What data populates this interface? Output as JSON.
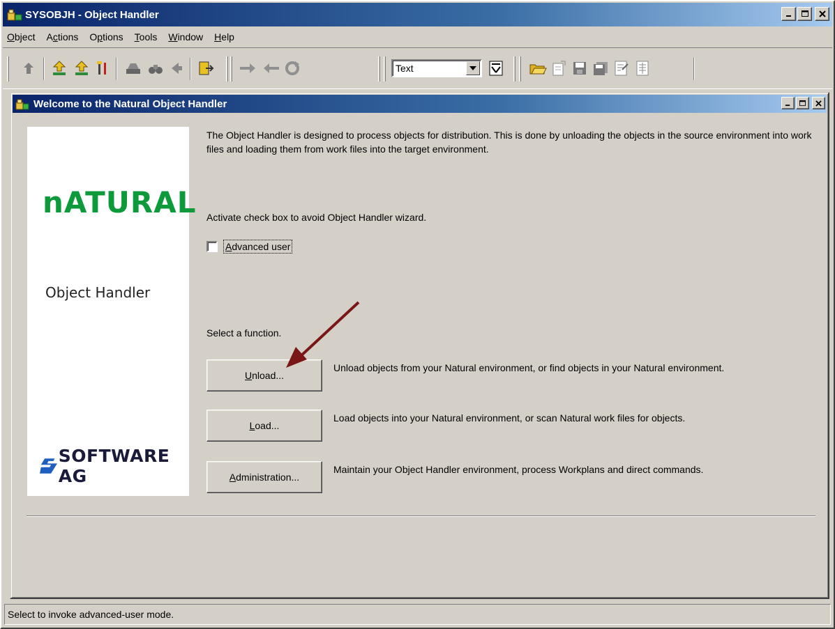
{
  "window": {
    "title": "SYSOBJH - Object Handler",
    "minimize": "_",
    "maximize": "□",
    "close": "×"
  },
  "menu": {
    "items": [
      {
        "label": "Object"
      },
      {
        "label": "Actions"
      },
      {
        "label": "Options"
      },
      {
        "label": "Tools"
      },
      {
        "label": "Window"
      },
      {
        "label": "Help"
      }
    ]
  },
  "toolbar": {
    "view_select_value": "Text",
    "icons": [
      "up-arrow-icon",
      "upload-icon",
      "upload-alt-icon",
      "tools-icon",
      "print-icon",
      "binoculars-icon",
      "back-icon",
      "exit-icon",
      "forward-arrow-icon",
      "back-arrow-icon",
      "refresh-icon",
      "view-icon",
      "open-folder-icon",
      "new-document-icon",
      "save-icon",
      "save-all-icon",
      "properties-icon",
      "list-icon"
    ]
  },
  "child_window": {
    "title": "Welcome to the Natural Object Handler"
  },
  "logo_panel": {
    "natural_logo": "nATURAL",
    "product_name": "Object Handler",
    "company_logo": "SOFTWARE AG"
  },
  "content": {
    "intro": "The Object Handler is designed to process objects for distribution. This is done by unloading the objects in the source environment into work files and loading them from work files into the target environment.",
    "checkbox_hint": "Activate check box to avoid Object Handler wizard.",
    "checkbox_label": "Advanced user",
    "checkbox_checked": false,
    "select_function": "Select a function.",
    "functions": [
      {
        "label": "Unload...",
        "description": "Unload objects from your Natural environment, or find objects in your Natural environment."
      },
      {
        "label": "Load...",
        "description": "Load objects into your Natural environment, or scan Natural work files for objects."
      },
      {
        "label": "Administration...",
        "description": "Maintain your Object Handler environment, process Workplans and direct commands."
      }
    ]
  },
  "status_bar": {
    "text": "Select to invoke advanced-user mode."
  },
  "colors": {
    "titlebar_start": "#0a246a",
    "titlebar_end": "#a6caf0",
    "natural_green": "#0d9a3a",
    "face": "#d4d0c8",
    "annotation_arrow": "#7b1616"
  }
}
